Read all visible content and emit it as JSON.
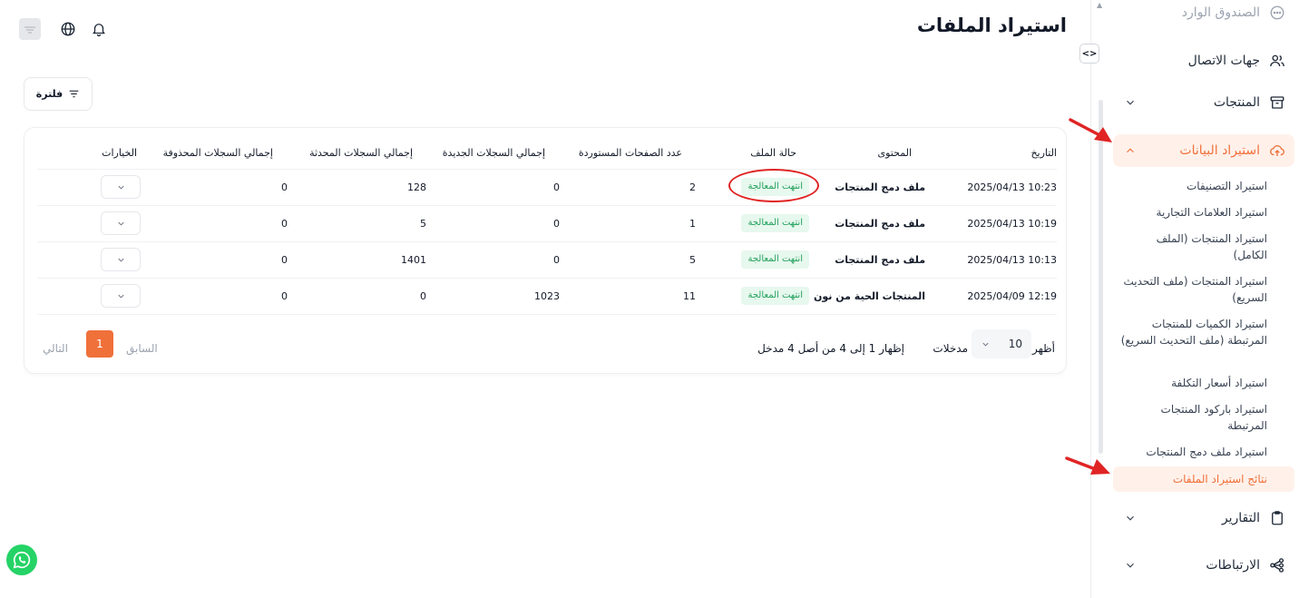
{
  "page": {
    "title": "استيراد الملفات"
  },
  "toolbar": {
    "filter_label": "فلترة"
  },
  "sidebar": {
    "top_items": [
      {
        "label": "الصندوق الوارد",
        "icon": "chat-icon"
      },
      {
        "label": "جهات الاتصال",
        "icon": "users-icon"
      },
      {
        "label": "المنتجات",
        "icon": "archive-icon"
      },
      {
        "label": "استيراد البيانات",
        "icon": "cloud-upload-icon",
        "active": true
      }
    ],
    "sub_items": [
      {
        "label": "استيراد التصنيفات"
      },
      {
        "label": "استيراد العلامات التجارية"
      },
      {
        "label": "استيراد المنتجات (الملف الكامل)"
      },
      {
        "label": "استيراد المنتجات (ملف التحديث السريع)"
      },
      {
        "label": "استيراد الكميات للمنتجات المرتبطة (ملف التحديث السريع)"
      },
      {
        "label": "استيراد أسعار التكلفة"
      },
      {
        "label": "استيراد باركود المنتجات المرتبطة"
      },
      {
        "label": "استيراد ملف دمج المنتجات"
      },
      {
        "label": "نتائج استيراد الملفات",
        "active": true
      }
    ],
    "bottom_items": [
      {
        "label": "التقارير",
        "icon": "clipboard-icon"
      },
      {
        "label": "الارتباطات",
        "icon": "integrations-icon"
      }
    ],
    "collapse_label": "<>"
  },
  "table": {
    "columns": {
      "date": "التاريخ",
      "content": "المحتوى",
      "status": "حالة الملف",
      "pages": "عدد الصفحات المستوردة",
      "new": "إجمالي السجلات الجديدة",
      "updated": "إجمالي السجلات المحدثة",
      "deleted": "إجمالي السجلات المحذوفة",
      "options": "الخيارات"
    },
    "rows": [
      {
        "date": "2025/04/13 10:23",
        "content": "ملف دمج المنتجات",
        "status": "انتهت المعالجة",
        "pages": "2",
        "new": "0",
        "updated": "128",
        "deleted": "0"
      },
      {
        "date": "2025/04/13 10:19",
        "content": "ملف دمج المنتجات",
        "status": "انتهت المعالجة",
        "pages": "1",
        "new": "0",
        "updated": "5",
        "deleted": "0"
      },
      {
        "date": "2025/04/13 10:13",
        "content": "ملف دمج المنتجات",
        "status": "انتهت المعالجة",
        "pages": "5",
        "new": "0",
        "updated": "1401",
        "deleted": "0"
      },
      {
        "date": "2025/04/09 12:19",
        "content": "المنتجات الحية من نون",
        "status": "انتهت المعالجة",
        "pages": "11",
        "new": "1023",
        "updated": "0",
        "deleted": "0"
      }
    ]
  },
  "pagination": {
    "show_label": "أظهر",
    "page_size": "10",
    "entries_label": "مدخلات",
    "summary": "إظهار 1 إلى 4 من أصل 4 مدخل",
    "prev_label": "السابق",
    "current_page": "1",
    "next_label": "التالي"
  },
  "colors": {
    "accent": "#f0703a",
    "status_bg": "#e7f8ee",
    "status_text": "#22a05b",
    "annotation": "#e02424"
  }
}
